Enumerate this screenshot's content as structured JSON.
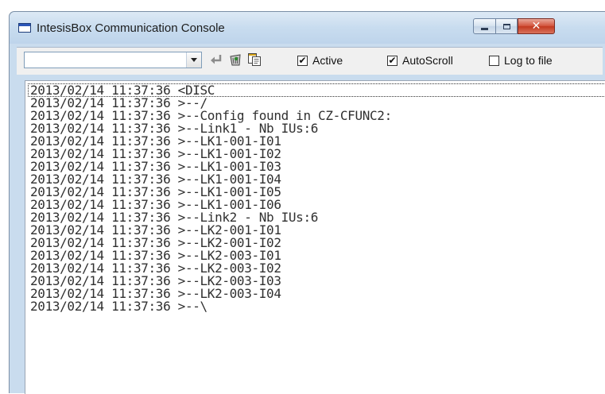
{
  "window": {
    "title": "IntesisBox Communication Console",
    "buttons": {
      "close_glyph": "✕"
    }
  },
  "toolbar": {
    "command_value": "",
    "icons": [
      "enter-icon",
      "clear-bin-icon",
      "copy-icon"
    ],
    "checkboxes": [
      {
        "label": "Active",
        "checked": true
      },
      {
        "label": "AutoScroll",
        "checked": true
      },
      {
        "label": "Log to file",
        "checked": false
      }
    ]
  },
  "console": {
    "lines": [
      "2013/02/14 11:37:36 <DISC",
      "2013/02/14 11:37:36 >--/",
      "2013/02/14 11:37:36 >--Config found in CZ-CFUNC2:",
      "2013/02/14 11:37:36 >--Link1 - Nb IUs:6",
      "2013/02/14 11:37:36 >--LK1-001-I01",
      "2013/02/14 11:37:36 >--LK1-001-I02",
      "2013/02/14 11:37:36 >--LK1-001-I03",
      "2013/02/14 11:37:36 >--LK1-001-I04",
      "2013/02/14 11:37:36 >--LK1-001-I05",
      "2013/02/14 11:37:36 >--LK1-001-I06",
      "2013/02/14 11:37:36 >--Link2 - Nb IUs:6",
      "2013/02/14 11:37:36 >--LK2-001-I01",
      "2013/02/14 11:37:36 >--LK2-001-I02",
      "2013/02/14 11:37:36 >--LK2-003-I01",
      "2013/02/14 11:37:36 >--LK2-003-I02",
      "2013/02/14 11:37:36 >--LK2-003-I03",
      "2013/02/14 11:37:36 >--LK2-003-I04",
      "2013/02/14 11:37:36 >--\\"
    ]
  },
  "colors": {
    "titlebar": "#c8dcef",
    "close_button": "#c2391f",
    "console_text": "#303030"
  }
}
